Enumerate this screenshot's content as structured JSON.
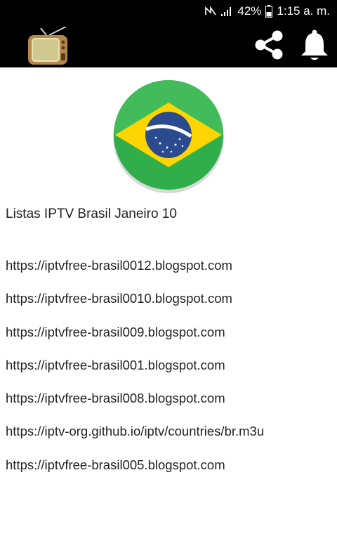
{
  "status_bar": {
    "battery_percent": "42%",
    "time": "1:15 a. m."
  },
  "app_bar": {
    "logo_icon": "tv-logo-icon",
    "actions": [
      {
        "name": "share",
        "icon": "share-icon"
      },
      {
        "name": "notifications",
        "icon": "bell-icon"
      }
    ]
  },
  "main": {
    "flag_icon": "brazil-flag-icon",
    "title": "Listas IPTV Brasil Janeiro 10",
    "links": [
      "https://iptvfree-brasil0012.blogspot.com",
      "https://iptvfree-brasil0010.blogspot.com",
      "https://iptvfree-brasil009.blogspot.com",
      "https://iptvfree-brasil001.blogspot.com",
      "https://iptvfree-brasil008.blogspot.com",
      "https://iptv-org.github.io/iptv/countries/br.m3u",
      "https://iptvfree-brasil005.blogspot.com"
    ]
  },
  "colors": {
    "bar_background": "#000000",
    "flag_green": "#2fae4a",
    "flag_yellow": "#ffd500",
    "flag_blue": "#2a4b8d"
  }
}
